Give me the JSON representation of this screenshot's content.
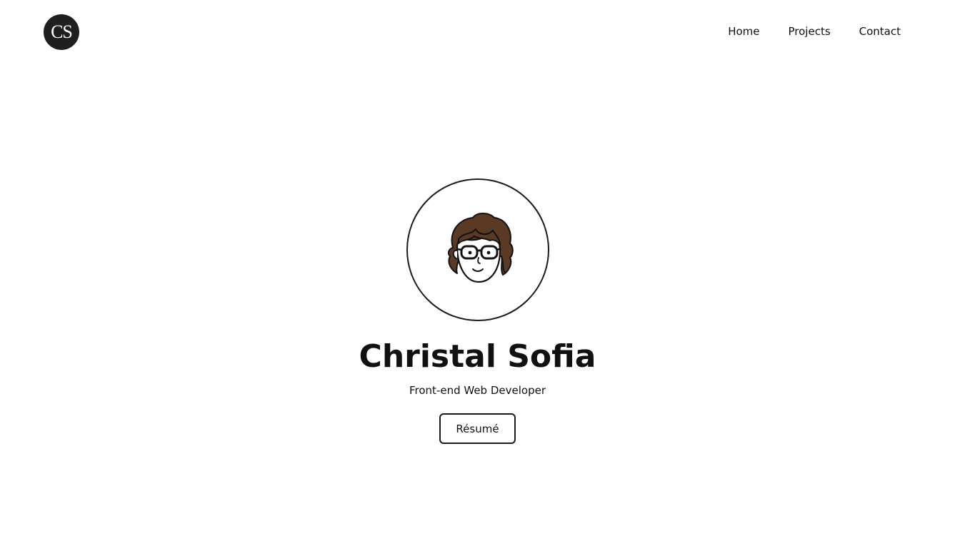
{
  "header": {
    "logo_text": "CS",
    "nav": {
      "home": "Home",
      "projects": "Projects",
      "contact": "Contact"
    }
  },
  "hero": {
    "avatar_icon": "cartoon-portrait-with-glasses",
    "name": "Christal Sofia",
    "role": "Front-end Web Developer",
    "resume_label": "Résumé"
  },
  "colors": {
    "text": "#111111",
    "logo_bg": "#1f1f1f",
    "hair": "#5a3a24",
    "border": "#1a1a1a"
  }
}
